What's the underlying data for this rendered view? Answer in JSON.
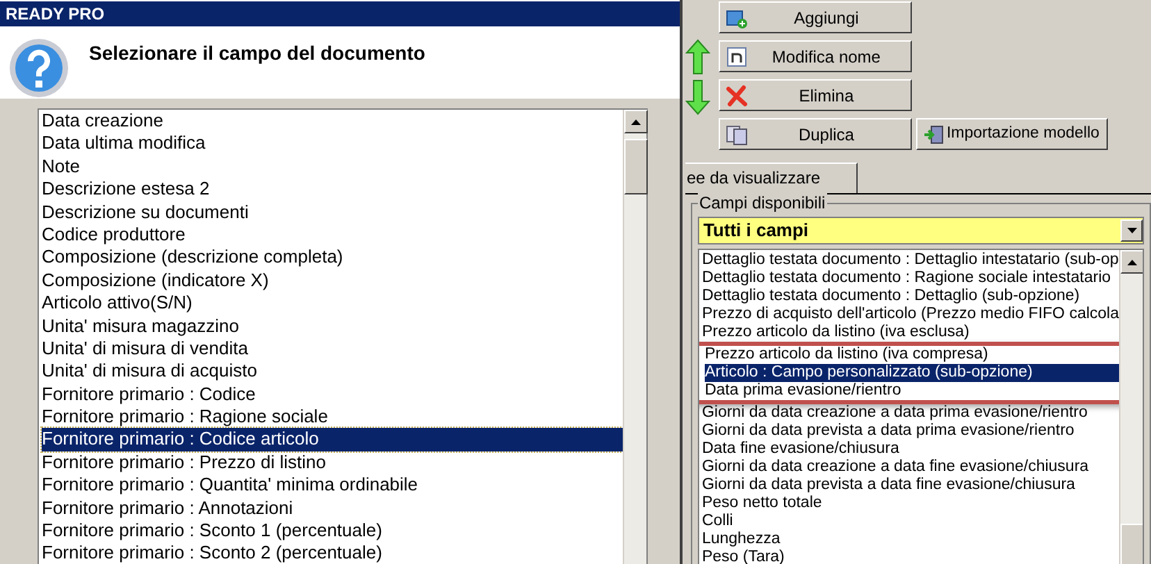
{
  "window": {
    "title": "READY PRO"
  },
  "dialog": {
    "prompt": "Selezionare il campo del documento",
    "fields": [
      {
        "label": "Data creazione",
        "selected": false
      },
      {
        "label": "Data ultima modifica",
        "selected": false
      },
      {
        "label": "Note",
        "selected": false
      },
      {
        "label": "Descrizione estesa 2",
        "selected": false
      },
      {
        "label": "Descrizione su documenti",
        "selected": false
      },
      {
        "label": "Codice produttore",
        "selected": false
      },
      {
        "label": "Composizione (descrizione completa)",
        "selected": false
      },
      {
        "label": "Composizione (indicatore X)",
        "selected": false
      },
      {
        "label": "Articolo attivo(S/N)",
        "selected": false
      },
      {
        "label": "Unita' misura magazzino",
        "selected": false
      },
      {
        "label": "Unita' di misura di vendita",
        "selected": false
      },
      {
        "label": "Unita' di misura di acquisto",
        "selected": false
      },
      {
        "label": "Fornitore primario : Codice",
        "selected": false
      },
      {
        "label": "Fornitore primario : Ragione sociale",
        "selected": false
      },
      {
        "label": "Fornitore primario : Codice articolo",
        "selected": true
      },
      {
        "label": "Fornitore primario : Prezzo di listino",
        "selected": false
      },
      {
        "label": "Fornitore primario : Quantita' minima ordinabile",
        "selected": false
      },
      {
        "label": "Fornitore primario : Annotazioni",
        "selected": false
      },
      {
        "label": "Fornitore primario : Sconto 1 (percentuale)",
        "selected": false
      },
      {
        "label": "Fornitore primario : Sconto 2 (percentuale)",
        "selected": false
      }
    ]
  },
  "toolbar": [
    {
      "label": "Aggiungi",
      "kind": "add"
    },
    {
      "label": "Modifica nome",
      "kind": "rename"
    },
    {
      "label": "Elimina",
      "kind": "delete"
    },
    {
      "label": "Duplica",
      "kind": "duplicate"
    },
    {
      "label": "Importazione modello",
      "kind": "import"
    }
  ],
  "tab": {
    "label": "ee da visualizzare",
    "selected": true
  },
  "available_fields": {
    "legend": "Campi disponibili",
    "filter": "Tutti i campi",
    "items": [
      {
        "label": "Dettaglio testata documento : Dettaglio intestatario (sub-op",
        "selected": false,
        "highlighted": false
      },
      {
        "label": "Dettaglio testata documento : Ragione sociale intestatario",
        "selected": false,
        "highlighted": false
      },
      {
        "label": "Dettaglio testata documento : Dettaglio (sub-opzione)",
        "selected": false,
        "highlighted": false
      },
      {
        "label": "Prezzo di acquisto dell'articolo (Prezzo medio FIFO calcola",
        "selected": false,
        "highlighted": false
      },
      {
        "label": "Prezzo articolo da listino (iva esclusa)",
        "selected": false,
        "highlighted": false
      },
      {
        "label": "Prezzo articolo da listino (iva compresa)",
        "selected": false,
        "highlighted": true
      },
      {
        "label": "Articolo : Campo personalizzato (sub-opzione)",
        "selected": true,
        "highlighted": true
      },
      {
        "label": "Data prima evasione/rientro",
        "selected": false,
        "highlighted": true
      },
      {
        "label": "Giorni da data creazione a data prima evasione/rientro",
        "selected": false,
        "highlighted": false
      },
      {
        "label": "Giorni da data prevista a data prima evasione/rientro",
        "selected": false,
        "highlighted": false
      },
      {
        "label": "Data fine evasione/chiusura",
        "selected": false,
        "highlighted": false
      },
      {
        "label": "Giorni da data creazione a data fine evasione/chiusura",
        "selected": false,
        "highlighted": false
      },
      {
        "label": "Giorni da data prevista a data fine evasione/chiusura",
        "selected": false,
        "highlighted": false
      },
      {
        "label": "Peso netto totale",
        "selected": false,
        "highlighted": false
      },
      {
        "label": "Colli",
        "selected": false,
        "highlighted": false
      },
      {
        "label": "Lunghezza",
        "selected": false,
        "highlighted": false
      },
      {
        "label": "Peso (Tara)",
        "selected": false,
        "highlighted": false
      }
    ]
  }
}
